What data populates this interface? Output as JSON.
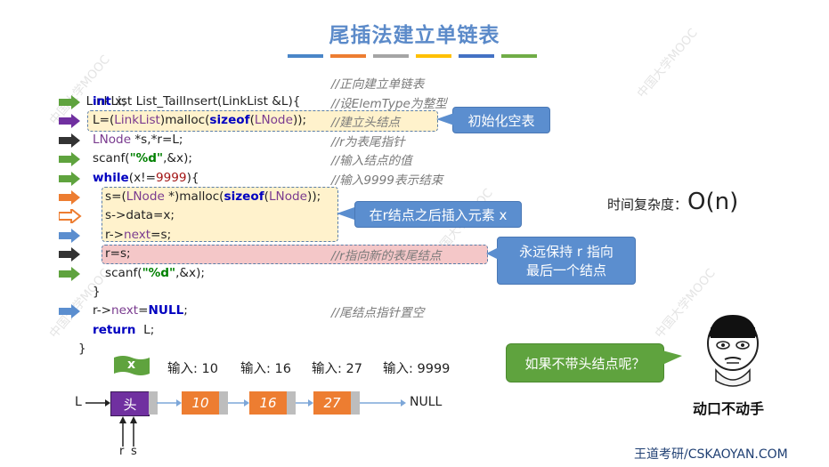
{
  "slide": {
    "title": "尾插法建立单链表",
    "title_bar_colors": [
      "#4a86c8",
      "#ed7d31",
      "#a5a5a5",
      "#ffc000",
      "#4472c4",
      "#70ad47"
    ],
    "watermark": "中国大学MOOC",
    "footer": "王道考研/CSKAOYAN.COM"
  },
  "code": {
    "header": "LinkList List_TailInsert(LinkList &L){",
    "header_comment": "//正向建立单链表",
    "lines": [
      {
        "text": "int x;",
        "comment": "//设ElemType为整型",
        "arrow": "green"
      },
      {
        "text": "L=(LinkList)malloc(sizeof(LNode));",
        "comment": "//建立头结点",
        "arrow": "purple"
      },
      {
        "text": "LNode *s,*r=L;",
        "comment": "//r为表尾指针",
        "arrow": "dark"
      },
      {
        "text": "scanf(\"%d\",&x);",
        "comment": "//输入结点的值",
        "arrow": "green"
      },
      {
        "text": "while(x!=9999){",
        "comment": "//输入9999表示结束",
        "arrow": "green"
      },
      {
        "text": "s=(LNode *)malloc(sizeof(LNode));",
        "comment": "",
        "arrow": "orange"
      },
      {
        "text": "s->data=x;",
        "comment": "",
        "arrow": "orange-outline"
      },
      {
        "text": "r->next=s;",
        "comment": "",
        "arrow": "blue"
      },
      {
        "text": "r=s;",
        "comment": "//r指向新的表尾结点",
        "arrow": "dark"
      },
      {
        "text": "scanf(\"%d\",&x);",
        "comment": "",
        "arrow": "green"
      },
      {
        "text": "}",
        "comment": "",
        "arrow": ""
      },
      {
        "text": "r->next=NULL;",
        "comment": "//尾结点指针置空",
        "arrow": "blue"
      },
      {
        "text": "return  L;",
        "comment": "",
        "arrow": ""
      },
      {
        "text": "}",
        "comment": "",
        "arrow": ""
      }
    ]
  },
  "callouts": {
    "init": "初始化空表",
    "insert": "在r结点之后插入元素 x",
    "keep_r_line1": "永远保持 r 指向",
    "keep_r_line2": "最后一个结点",
    "question": "如果不带头结点呢？"
  },
  "complexity": {
    "label": "时间复杂度：",
    "value": "O(n)"
  },
  "meme": {
    "caption": "动口不动手"
  },
  "inputs": {
    "flag": "x",
    "items": [
      "输入: 10",
      "输入: 16",
      "输入: 27",
      "输入: 9999"
    ]
  },
  "list": {
    "head_pointer": "L",
    "head_node": "头",
    "nodes": [
      "10",
      "16",
      "27"
    ],
    "null": "NULL",
    "pointer_r": "r",
    "pointer_s": "s",
    "colors": {
      "head": "#7030a0",
      "node": "#ed7d31"
    }
  }
}
